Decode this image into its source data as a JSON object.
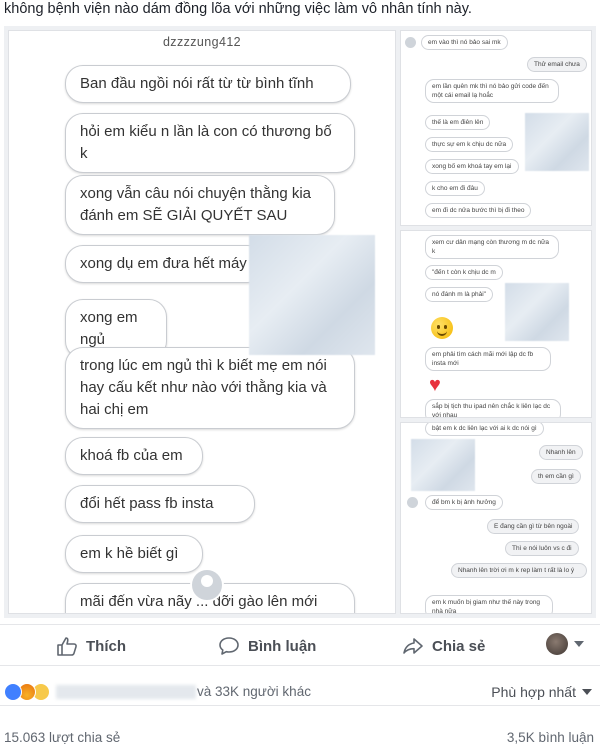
{
  "caption": "không bệnh viện nào dám đồng lõa với những việc làm vô nhân tính này.",
  "chat_left": {
    "username": "dzzzzung412",
    "messages": [
      "Ban đầu ngồi nói rất từ từ bình tĩnh",
      "hỏi em kiểu n lần là con có thương bố k",
      "xong vẫn câu nói chuyện thằng kia đánh em SẼ GIẢI QUYẾT SAU",
      "xong dụ em đưa hết máy",
      "xong em ngủ",
      "trong lúc em ngủ thì k biết mẹ em nói hay cấu kết như nào với thằng kia và hai chị em",
      "khoá fb của em",
      "đổi hết pass fb insta",
      "em k hề biết gì",
      "mãi đến vừa nãy ... dỡi gào lên mới đưa ipad"
    ]
  },
  "chat_right_top": [
    "em vào thì nó bảo sai mk",
    "Thử email chưa",
    "em lần quên mk thì nó bảo gửi code đến một cái email lạ hoắc",
    "thế là em điên lên",
    "thực sự em k chịu dc nữa",
    "xong bố em khoá tay em lại",
    "k cho em đi đâu",
    "em đi dc nửa bước thì bị đi theo"
  ],
  "chat_right_mid": [
    "xem cư dân mạng còn thương m dc nữa k",
    "\"đến t còn k chịu dc m",
    "nó đánh m là phải\"",
    "em phải tìm cách mãi mới lập dc fb insta mới",
    "sắp bị tịch thu ipad nên chắc k liên lạc dc với nhau",
    "bật em k dc liên lạc với ai k dc nói gì"
  ],
  "chat_right_bottom": [
    "Nhanh lên",
    "th em cần gì",
    "để bm k bị ảnh hưởng",
    "E đang cần gì từ bên ngoài",
    "Thì e nói luôn vs c đi",
    "Nhanh lên trời ơi m k rep làm t rất là lo ý",
    "em k muốn bị giam như thế này trong nhà nữa"
  ],
  "actions": {
    "like_label": "Thích",
    "comment_label": "Bình luận",
    "share_label": "Chia sẻ"
  },
  "reactions": {
    "others_text": "và 33K người khác",
    "sort_label": "Phù hợp nhất"
  },
  "footer": {
    "shares_text": "15.063 lượt chia sẻ",
    "comments_text": "3,5K bình luận"
  },
  "colors": {
    "like_blue": "#4080ff",
    "text_gray": "#4b4f56",
    "heart_red": "#e8323e"
  }
}
